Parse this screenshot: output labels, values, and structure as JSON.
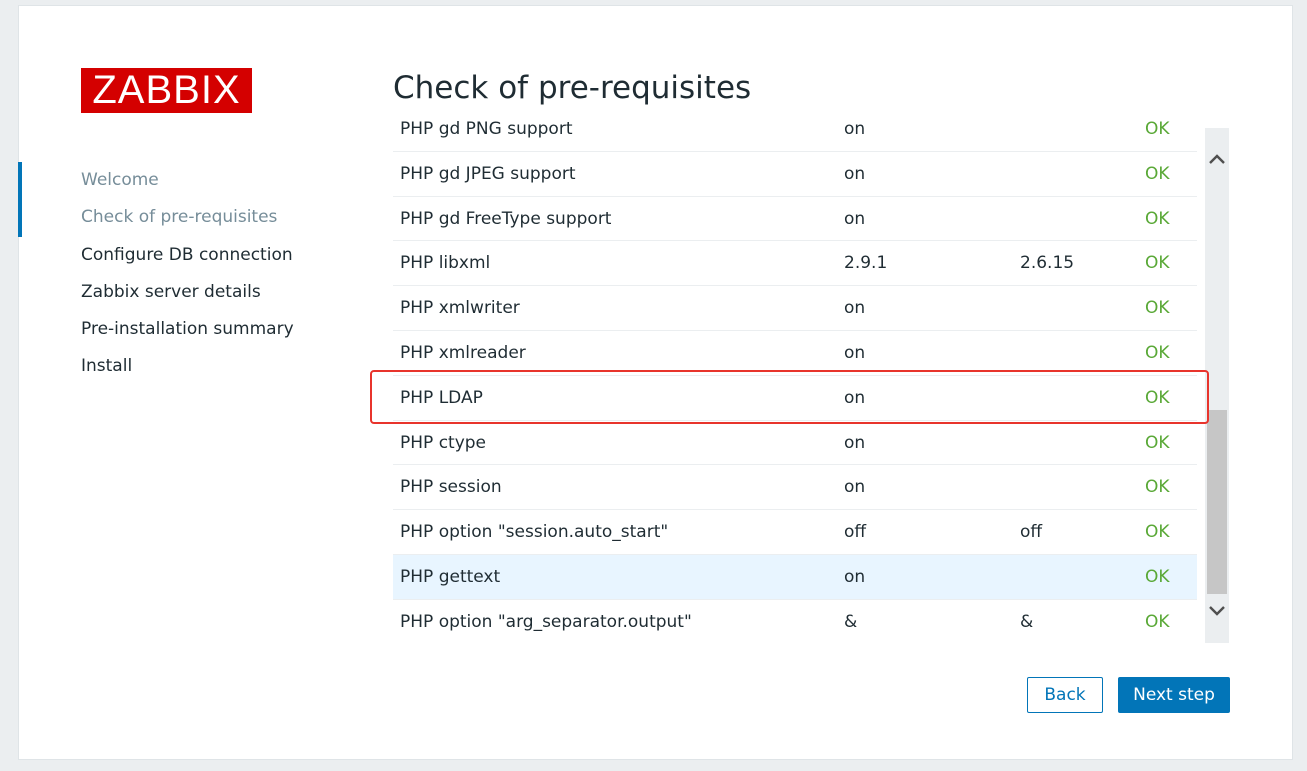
{
  "logo": {
    "text": "ZABBIX"
  },
  "page_title": "Check of pre-requisites",
  "nav": {
    "items": [
      {
        "label": "Welcome",
        "state": "done"
      },
      {
        "label": "Check of pre-requisites",
        "state": "current"
      },
      {
        "label": "Configure DB connection",
        "state": "todo"
      },
      {
        "label": "Zabbix server details",
        "state": "todo"
      },
      {
        "label": "Pre-installation summary",
        "state": "todo"
      },
      {
        "label": "Install",
        "state": "todo"
      }
    ]
  },
  "requirements": {
    "rows": [
      {
        "name": "PHP gd PNG support",
        "current": "on",
        "required": "",
        "result": "OK"
      },
      {
        "name": "PHP gd JPEG support",
        "current": "on",
        "required": "",
        "result": "OK"
      },
      {
        "name": "PHP gd FreeType support",
        "current": "on",
        "required": "",
        "result": "OK"
      },
      {
        "name": "PHP libxml",
        "current": "2.9.1",
        "required": "2.6.15",
        "result": "OK"
      },
      {
        "name": "PHP xmlwriter",
        "current": "on",
        "required": "",
        "result": "OK"
      },
      {
        "name": "PHP xmlreader",
        "current": "on",
        "required": "",
        "result": "OK"
      },
      {
        "name": "PHP LDAP",
        "current": "on",
        "required": "",
        "result": "OK"
      },
      {
        "name": "PHP ctype",
        "current": "on",
        "required": "",
        "result": "OK"
      },
      {
        "name": "PHP session",
        "current": "on",
        "required": "",
        "result": "OK"
      },
      {
        "name": "PHP option \"session.auto_start\"",
        "current": "off",
        "required": "off",
        "result": "OK"
      },
      {
        "name": "PHP gettext",
        "current": "on",
        "required": "",
        "result": "OK"
      },
      {
        "name": "PHP option \"arg_separator.output\"",
        "current": "&",
        "required": "&",
        "result": "OK"
      }
    ]
  },
  "buttons": {
    "back": "Back",
    "next": "Next step"
  },
  "colors": {
    "brand": "#d40000",
    "accent": "#0275b8",
    "ok": "#59a836",
    "highlight_box": "#e8342c",
    "row_hover": "#e8f5ff"
  },
  "icons": {
    "scroll_up": "chevron-up-icon",
    "scroll_down": "chevron-down-icon"
  }
}
